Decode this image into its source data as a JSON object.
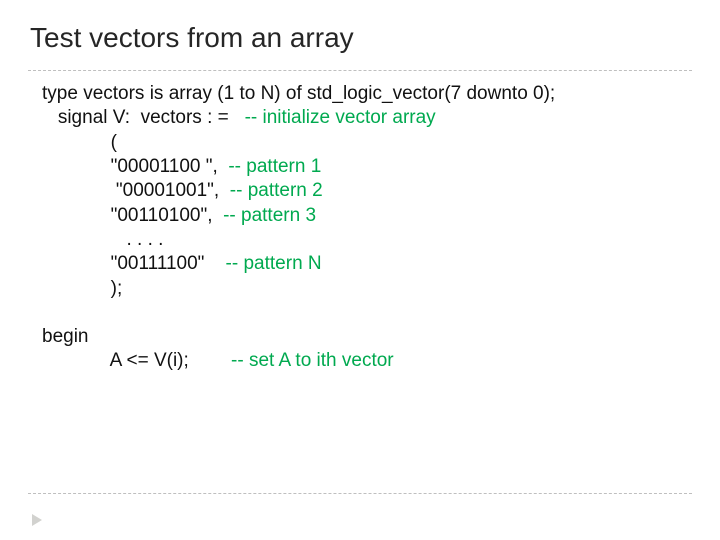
{
  "title": "Test vectors from an array",
  "code": {
    "decl": "type vectors is array (1 to N) of std_logic_vector(7 downto 0);",
    "sigPrefix": "   signal V:  vectors : =   ",
    "sigComment": "-- initialize vector array",
    "openParen": "             (",
    "p1Prefix": "             \"00001100 \",  ",
    "p1Comment": "-- pattern 1",
    "p2Prefix": "              \"00001001\",  ",
    "p2Comment": "-- pattern 2",
    "p3Prefix": "             \"00110100\",  ",
    "p3Comment": "-- pattern 3",
    "dots": "                . . . .",
    "pnPrefix": "             \"00111100\"    ",
    "pnComment": "-- pattern N",
    "closeParen": "             );",
    "beginLine": "begin",
    "assignPrefix": "             A <= V(i);        ",
    "assignComment": "-- set A to ith vector"
  }
}
